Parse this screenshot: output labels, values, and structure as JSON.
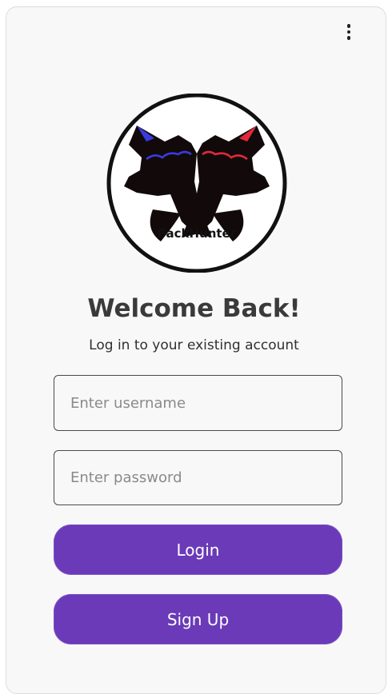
{
  "header": {
    "menu_icon": "more-vertical-icon"
  },
  "logo": {
    "text": "PackHunter",
    "icon": "twin-wolves-logo"
  },
  "welcome": {
    "title": "Welcome Back!",
    "subtitle": "Log in to your existing account"
  },
  "form": {
    "username_placeholder": "Enter username",
    "username_value": "",
    "password_placeholder": "Enter password",
    "password_value": ""
  },
  "buttons": {
    "login_label": "Login",
    "signup_label": "Sign Up"
  },
  "colors": {
    "accent": "#6a3ab8",
    "wolf_left_accent": "#3a3ae0",
    "wolf_right_accent": "#e02a3a",
    "text_dark": "#3a3a3a"
  }
}
